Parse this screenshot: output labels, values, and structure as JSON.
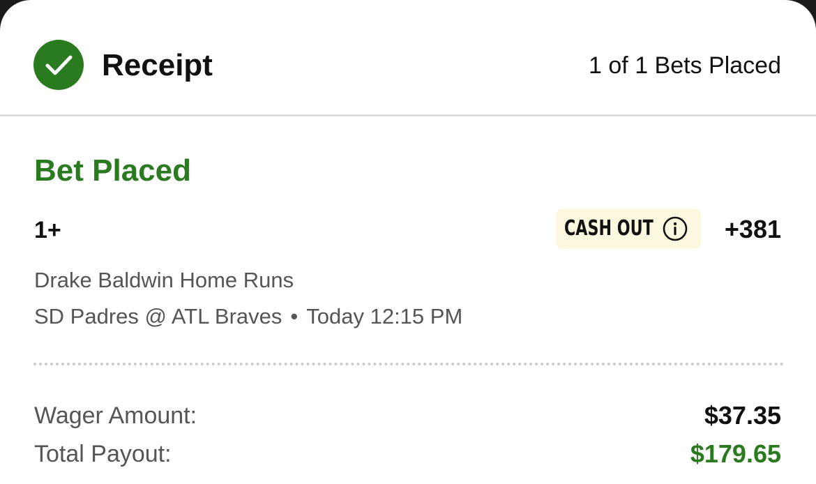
{
  "header": {
    "title": "Receipt",
    "bets_placed": "1 of 1 Bets Placed"
  },
  "bet": {
    "status": "Bet Placed",
    "selection": "1+",
    "cash_out_label": "CASH OUT",
    "odds": "+381",
    "market": "Drake Baldwin Home Runs",
    "event": {
      "matchup": "SD Padres @ ATL Braves",
      "separator": "•",
      "time": "Today 12:15 PM"
    }
  },
  "summary": {
    "wager_label": "Wager Amount:",
    "wager_value": "$37.35",
    "payout_label": "Total Payout:",
    "payout_value": "$179.65"
  },
  "icons": {
    "status": "check-circle-icon",
    "cash_out_info": "info-icon"
  },
  "colors": {
    "accent_green": "#2a7a1f",
    "cash_out_bg": "#fbf8df",
    "text_primary": "#111111",
    "text_secondary": "#555555"
  }
}
